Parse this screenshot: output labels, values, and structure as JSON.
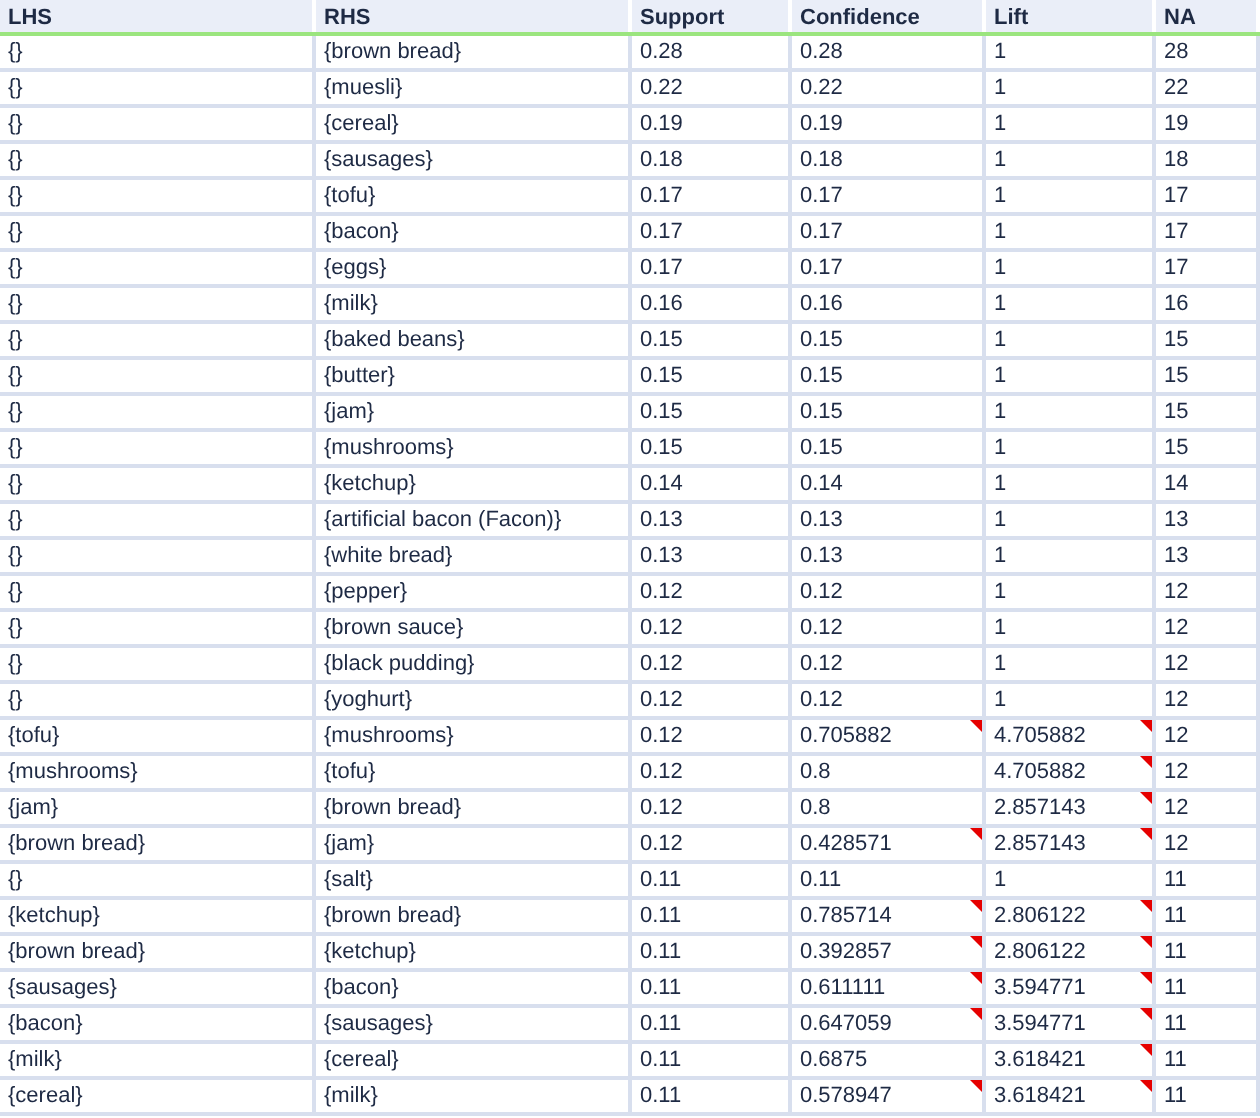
{
  "table": {
    "columns": [
      "LHS",
      "RHS",
      "Support",
      "Confidence",
      "Lift",
      "NA"
    ],
    "rows": [
      {
        "lhs": "{}",
        "rhs": "{brown bread}",
        "support": "0.28",
        "confidence": "0.28",
        "confidence_marked": false,
        "lift": "1",
        "lift_marked": false,
        "na": "28"
      },
      {
        "lhs": "{}",
        "rhs": "{muesli}",
        "support": "0.22",
        "confidence": "0.22",
        "confidence_marked": false,
        "lift": "1",
        "lift_marked": false,
        "na": "22"
      },
      {
        "lhs": "{}",
        "rhs": "{cereal}",
        "support": "0.19",
        "confidence": "0.19",
        "confidence_marked": false,
        "lift": "1",
        "lift_marked": false,
        "na": "19"
      },
      {
        "lhs": "{}",
        "rhs": "{sausages}",
        "support": "0.18",
        "confidence": "0.18",
        "confidence_marked": false,
        "lift": "1",
        "lift_marked": false,
        "na": "18"
      },
      {
        "lhs": "{}",
        "rhs": "{tofu}",
        "support": "0.17",
        "confidence": "0.17",
        "confidence_marked": false,
        "lift": "1",
        "lift_marked": false,
        "na": "17"
      },
      {
        "lhs": "{}",
        "rhs": "{bacon}",
        "support": "0.17",
        "confidence": "0.17",
        "confidence_marked": false,
        "lift": "1",
        "lift_marked": false,
        "na": "17"
      },
      {
        "lhs": "{}",
        "rhs": "{eggs}",
        "support": "0.17",
        "confidence": "0.17",
        "confidence_marked": false,
        "lift": "1",
        "lift_marked": false,
        "na": "17"
      },
      {
        "lhs": "{}",
        "rhs": "{milk}",
        "support": "0.16",
        "confidence": "0.16",
        "confidence_marked": false,
        "lift": "1",
        "lift_marked": false,
        "na": "16"
      },
      {
        "lhs": "{}",
        "rhs": "{baked beans}",
        "support": "0.15",
        "confidence": "0.15",
        "confidence_marked": false,
        "lift": "1",
        "lift_marked": false,
        "na": "15"
      },
      {
        "lhs": "{}",
        "rhs": "{butter}",
        "support": "0.15",
        "confidence": "0.15",
        "confidence_marked": false,
        "lift": "1",
        "lift_marked": false,
        "na": "15"
      },
      {
        "lhs": "{}",
        "rhs": "{jam}",
        "support": "0.15",
        "confidence": "0.15",
        "confidence_marked": false,
        "lift": "1",
        "lift_marked": false,
        "na": "15"
      },
      {
        "lhs": "{}",
        "rhs": "{mushrooms}",
        "support": "0.15",
        "confidence": "0.15",
        "confidence_marked": false,
        "lift": "1",
        "lift_marked": false,
        "na": "15"
      },
      {
        "lhs": "{}",
        "rhs": "{ketchup}",
        "support": "0.14",
        "confidence": "0.14",
        "confidence_marked": false,
        "lift": "1",
        "lift_marked": false,
        "na": "14"
      },
      {
        "lhs": "{}",
        "rhs": "{artificial bacon (Facon)}",
        "support": "0.13",
        "confidence": "0.13",
        "confidence_marked": false,
        "lift": "1",
        "lift_marked": false,
        "na": "13"
      },
      {
        "lhs": "{}",
        "rhs": "{white bread}",
        "support": "0.13",
        "confidence": "0.13",
        "confidence_marked": false,
        "lift": "1",
        "lift_marked": false,
        "na": "13"
      },
      {
        "lhs": "{}",
        "rhs": "{pepper}",
        "support": "0.12",
        "confidence": "0.12",
        "confidence_marked": false,
        "lift": "1",
        "lift_marked": false,
        "na": "12"
      },
      {
        "lhs": "{}",
        "rhs": "{brown sauce}",
        "support": "0.12",
        "confidence": "0.12",
        "confidence_marked": false,
        "lift": "1",
        "lift_marked": false,
        "na": "12"
      },
      {
        "lhs": "{}",
        "rhs": "{black pudding}",
        "support": "0.12",
        "confidence": "0.12",
        "confidence_marked": false,
        "lift": "1",
        "lift_marked": false,
        "na": "12"
      },
      {
        "lhs": "{}",
        "rhs": "{yoghurt}",
        "support": "0.12",
        "confidence": "0.12",
        "confidence_marked": false,
        "lift": "1",
        "lift_marked": false,
        "na": "12"
      },
      {
        "lhs": "{tofu}",
        "rhs": "{mushrooms}",
        "support": "0.12",
        "confidence": "0.705882",
        "confidence_marked": true,
        "lift": "4.705882",
        "lift_marked": true,
        "na": "12"
      },
      {
        "lhs": "{mushrooms}",
        "rhs": "{tofu}",
        "support": "0.12",
        "confidence": "0.8",
        "confidence_marked": false,
        "lift": "4.705882",
        "lift_marked": true,
        "na": "12"
      },
      {
        "lhs": "{jam}",
        "rhs": "{brown bread}",
        "support": "0.12",
        "confidence": "0.8",
        "confidence_marked": false,
        "lift": "2.857143",
        "lift_marked": true,
        "na": "12"
      },
      {
        "lhs": "{brown bread}",
        "rhs": "{jam}",
        "support": "0.12",
        "confidence": "0.428571",
        "confidence_marked": true,
        "lift": "2.857143",
        "lift_marked": true,
        "na": "12"
      },
      {
        "lhs": "{}",
        "rhs": "{salt}",
        "support": "0.11",
        "confidence": "0.11",
        "confidence_marked": false,
        "lift": "1",
        "lift_marked": false,
        "na": "11"
      },
      {
        "lhs": "{ketchup}",
        "rhs": "{brown bread}",
        "support": "0.11",
        "confidence": "0.785714",
        "confidence_marked": true,
        "lift": "2.806122",
        "lift_marked": true,
        "na": "11"
      },
      {
        "lhs": "{brown bread}",
        "rhs": "{ketchup}",
        "support": "0.11",
        "confidence": "0.392857",
        "confidence_marked": true,
        "lift": "2.806122",
        "lift_marked": true,
        "na": "11"
      },
      {
        "lhs": "{sausages}",
        "rhs": "{bacon}",
        "support": "0.11",
        "confidence": "0.611111",
        "confidence_marked": true,
        "lift": "3.594771",
        "lift_marked": true,
        "na": "11"
      },
      {
        "lhs": "{bacon}",
        "rhs": "{sausages}",
        "support": "0.11",
        "confidence": "0.647059",
        "confidence_marked": true,
        "lift": "3.594771",
        "lift_marked": true,
        "na": "11"
      },
      {
        "lhs": "{milk}",
        "rhs": "{cereal}",
        "support": "0.11",
        "confidence": "0.6875",
        "confidence_marked": false,
        "lift": "3.618421",
        "lift_marked": true,
        "na": "11"
      },
      {
        "lhs": "{cereal}",
        "rhs": "{milk}",
        "support": "0.11",
        "confidence": "0.578947",
        "confidence_marked": true,
        "lift": "3.618421",
        "lift_marked": true,
        "na": "11"
      }
    ]
  }
}
